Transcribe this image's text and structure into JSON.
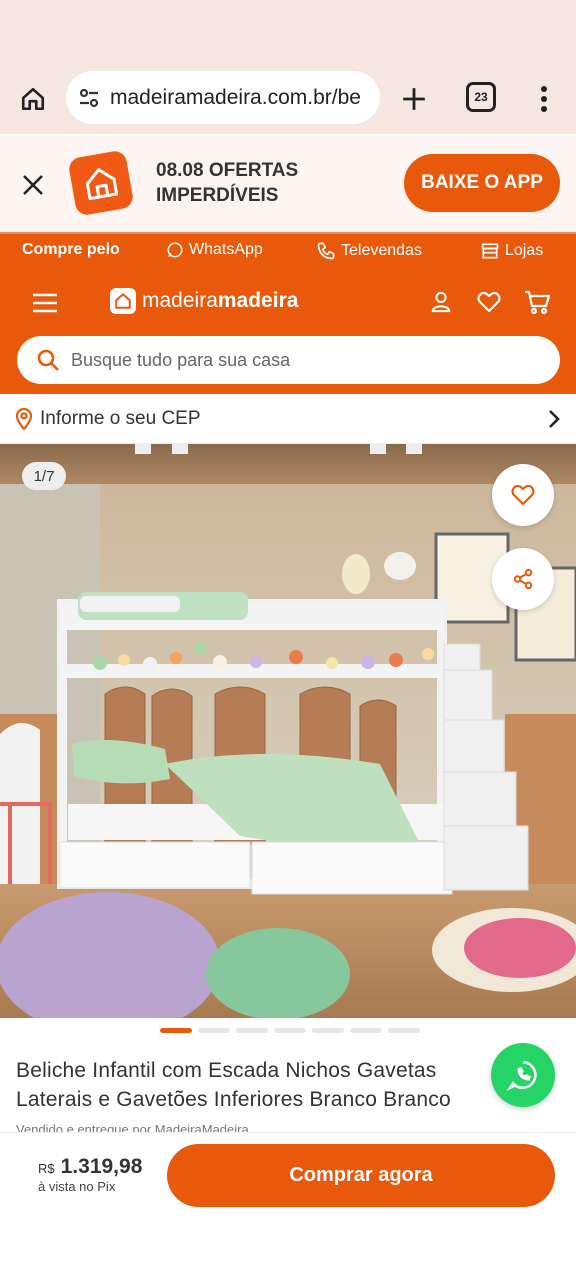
{
  "browser": {
    "url": "madeiramadeira.com.br/be",
    "tab_count": "23"
  },
  "banner": {
    "promo_line1": "08.08 OFERTAS",
    "promo_line2": "IMPERDÍVEIS",
    "app_button": "BAIXE O APP"
  },
  "contact_strip": {
    "label": "Compre pelo",
    "whatsapp": "WhatsApp",
    "televendas": "Televendas",
    "lojas": "Lojas"
  },
  "header": {
    "brand_light": "madeira",
    "brand_bold": "madeira",
    "search_placeholder": "Busque tudo para sua casa"
  },
  "cep": {
    "text": "Informe o seu CEP"
  },
  "gallery": {
    "counter": "1/7",
    "current_index": 1,
    "total": 7
  },
  "product": {
    "title": "Beliche Infantil com Escada Nichos Gavetas Laterais e Gavetões Inferiores Branco Branco",
    "seller": "Vendido e entregue por MadeiraMadeira",
    "currency": "R$",
    "price": "1.319,98",
    "payment_note": "à vista no Pix",
    "buy_button": "Comprar agora"
  },
  "colors": {
    "brand_orange": "#e8590c",
    "whatsapp_green": "#25d366",
    "browser_bg": "#f6e7e1"
  }
}
